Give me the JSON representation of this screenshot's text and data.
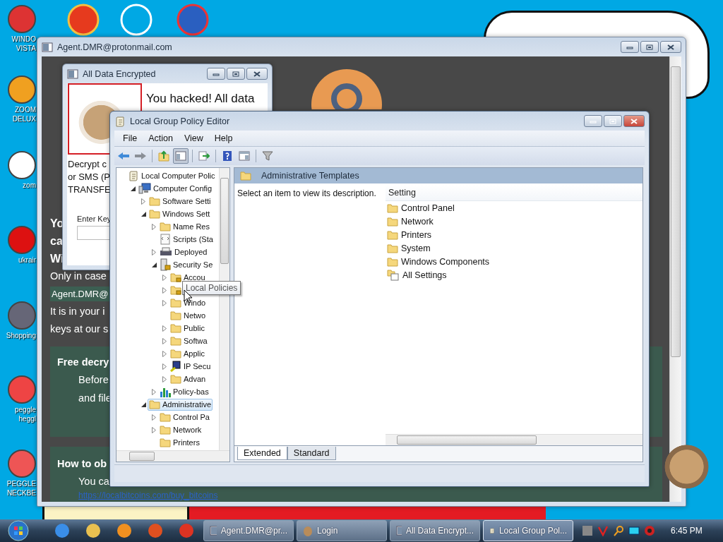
{
  "desktop": {
    "icons": [
      {
        "label": "WINDO VISTA"
      },
      {
        "label": "ZOOM DELUX"
      },
      {
        "label": "zom"
      },
      {
        "label": "ukrair"
      },
      {
        "label": "Shopping"
      },
      {
        "label": "peggle heggl"
      },
      {
        "label": "PEGGLE NECKBE"
      }
    ]
  },
  "agent_window": {
    "title": "Agent.DMR@protonmail.com",
    "headings": [
      "Yo",
      "ca",
      "Wi"
    ],
    "line": "Only in case",
    "email": "Agent.DMR@",
    "lines": [
      "It is in your i",
      "keys at our s"
    ],
    "cards": [
      {
        "title": "Free decry",
        "lines": [
          "Before",
          "and file"
        ]
      },
      {
        "title": "How to ob",
        "lines": [
          "You ca"
        ],
        "link": "https://localbitcoins.com/buy_bitcoins"
      }
    ]
  },
  "encrypted_window": {
    "title": "All Data Encrypted",
    "headline": "You hacked! All data",
    "lines": [
      "Decrypt c",
      "or SMS (P",
      "TRANSFE"
    ],
    "key_label": "Enter Key"
  },
  "gpe_window": {
    "title": "Local Group Policy Editor",
    "menu": [
      "File",
      "Action",
      "View",
      "Help"
    ],
    "toolbar": [
      {
        "kind": "back"
      },
      {
        "kind": "forward"
      },
      {
        "kind": "up"
      },
      {
        "kind": "tree",
        "selected": true
      },
      {
        "kind": "export"
      },
      {
        "kind": "help"
      },
      {
        "kind": "properties"
      },
      {
        "kind": "filter"
      }
    ],
    "tree": [
      {
        "label": "Local Computer Polic",
        "kind": "scroll",
        "arrow": false,
        "selected": false,
        "children": [
          {
            "label": "Computer Config",
            "kind": "computer",
            "arrow": true,
            "expanded": true,
            "selected": false,
            "children": [
              {
                "label": "Software Setti",
                "kind": "folder",
                "arrow": true,
                "expanded": false,
                "selected": false
              },
              {
                "label": "Windows Sett",
                "kind": "folder",
                "arrow": true,
                "expanded": true,
                "selected": false,
                "children": [
                  {
                    "label": "Name Res",
                    "kind": "folder",
                    "arrow": true,
                    "expanded": false,
                    "selected": false
                  },
                  {
                    "label": "Scripts (Sta",
                    "kind": "script",
                    "arrow": false,
                    "selected": false
                  },
                  {
                    "label": "Deployed",
                    "kind": "printer",
                    "arrow": true,
                    "expanded": false,
                    "selected": false
                  },
                  {
                    "label": "Security Se",
                    "kind": "security",
                    "arrow": true,
                    "expanded": true,
                    "selected": false,
                    "children": [
                      {
                        "label": "Accou",
                        "kind": "locked",
                        "arrow": true,
                        "expanded": false,
                        "selected": false
                      },
                      {
                        "kind": "locked",
                        "arrow": true,
                        "expanded": false,
                        "selected": false
                      },
                      {
                        "label": "Windo",
                        "kind": "folder",
                        "arrow": true,
                        "expanded": false,
                        "selected": false
                      },
                      {
                        "label": "Netwo",
                        "kind": "folder",
                        "arrow": false,
                        "selected": false
                      },
                      {
                        "label": "Public",
                        "kind": "folder",
                        "arrow": true,
                        "expanded": false,
                        "selected": false
                      },
                      {
                        "label": "Softwa",
                        "kind": "folder",
                        "arrow": true,
                        "expanded": false,
                        "selected": false
                      },
                      {
                        "label": "Applic",
                        "kind": "folder",
                        "arrow": true,
                        "expanded": false,
                        "selected": false
                      },
                      {
                        "label": "IP Secu",
                        "kind": "ip",
                        "arrow": true,
                        "expanded": false,
                        "selected": false
                      },
                      {
                        "label": "Advan",
                        "kind": "folder",
                        "arrow": true,
                        "expanded": false,
                        "selected": false
                      }
                    ]
                  },
                  {
                    "label": "Policy-bas",
                    "kind": "chart",
                    "arrow": true,
                    "expanded": false,
                    "selected": false
                  }
                ]
              },
              {
                "label": "Administrative",
                "kind": "folder",
                "arrow": true,
                "expanded": true,
                "selected": true,
                "children": [
                  {
                    "label": "Control Pa",
                    "kind": "folder",
                    "arrow": true,
                    "expanded": false,
                    "selected": false
                  },
                  {
                    "label": "Network",
                    "kind": "folder",
                    "arrow": true,
                    "expanded": false,
                    "selected": false
                  },
                  {
                    "label": "Printers",
                    "kind": "folder",
                    "arrow": false,
                    "selected": false
                  }
                ]
              }
            ]
          }
        ]
      }
    ],
    "tooltip": "Local Policies",
    "pane_title": "Administrative Templates",
    "description": "Select an item to view its description.",
    "column": "Setting",
    "items": [
      {
        "label": "Control Panel",
        "kind": "folder"
      },
      {
        "label": "Network",
        "kind": "folder"
      },
      {
        "label": "Printers",
        "kind": "folder"
      },
      {
        "label": "System",
        "kind": "folder"
      },
      {
        "label": "Windows Components",
        "kind": "folder"
      },
      {
        "label": "All Settings",
        "kind": "settings"
      }
    ],
    "tabs": [
      {
        "label": "Extended",
        "selected": true
      },
      {
        "label": "Standard",
        "selected": false
      }
    ]
  },
  "taskbar": {
    "tasks": [
      {
        "label": "Agent.DMR@pr...",
        "kind": "window",
        "selected": false
      },
      {
        "label": "Login",
        "kind": "hamster",
        "selected": false
      },
      {
        "label": "All Data Encrypt...",
        "kind": "window",
        "selected": false
      },
      {
        "label": "Local Group Pol...",
        "kind": "scroll",
        "selected": true
      }
    ],
    "clock": "6:45 PM"
  }
}
